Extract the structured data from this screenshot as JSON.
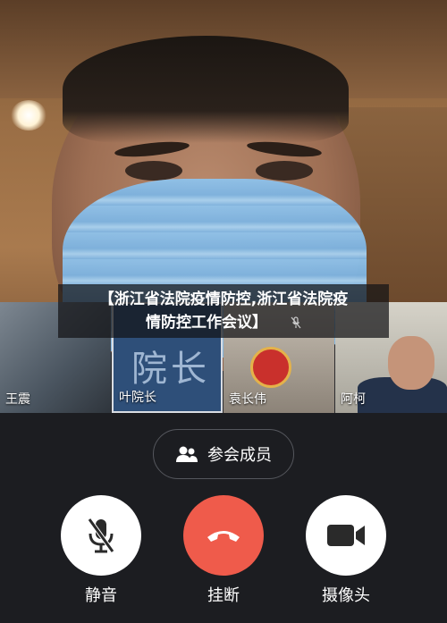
{
  "title_overlay": {
    "line1": "【浙江省法院疫情防控,浙江省法院疫",
    "line2": "情防控工作会议】"
  },
  "participants": [
    {
      "name": "王震"
    },
    {
      "name": "叶院长",
      "background_text": "院长"
    },
    {
      "name": "袁长伟"
    },
    {
      "name": "阿柯"
    }
  ],
  "controls": {
    "members_label": "参会成员",
    "mute_label": "静音",
    "hangup_label": "挂断",
    "camera_label": "摄像头"
  },
  "colors": {
    "hangup": "#ef5b4b",
    "control_bg": "#ffffff",
    "panel_bg": "#1c1d21"
  },
  "icons": {
    "members": "people-icon",
    "mute": "mic-muted-icon",
    "hangup": "phone-hangup-icon",
    "camera": "video-camera-icon"
  }
}
